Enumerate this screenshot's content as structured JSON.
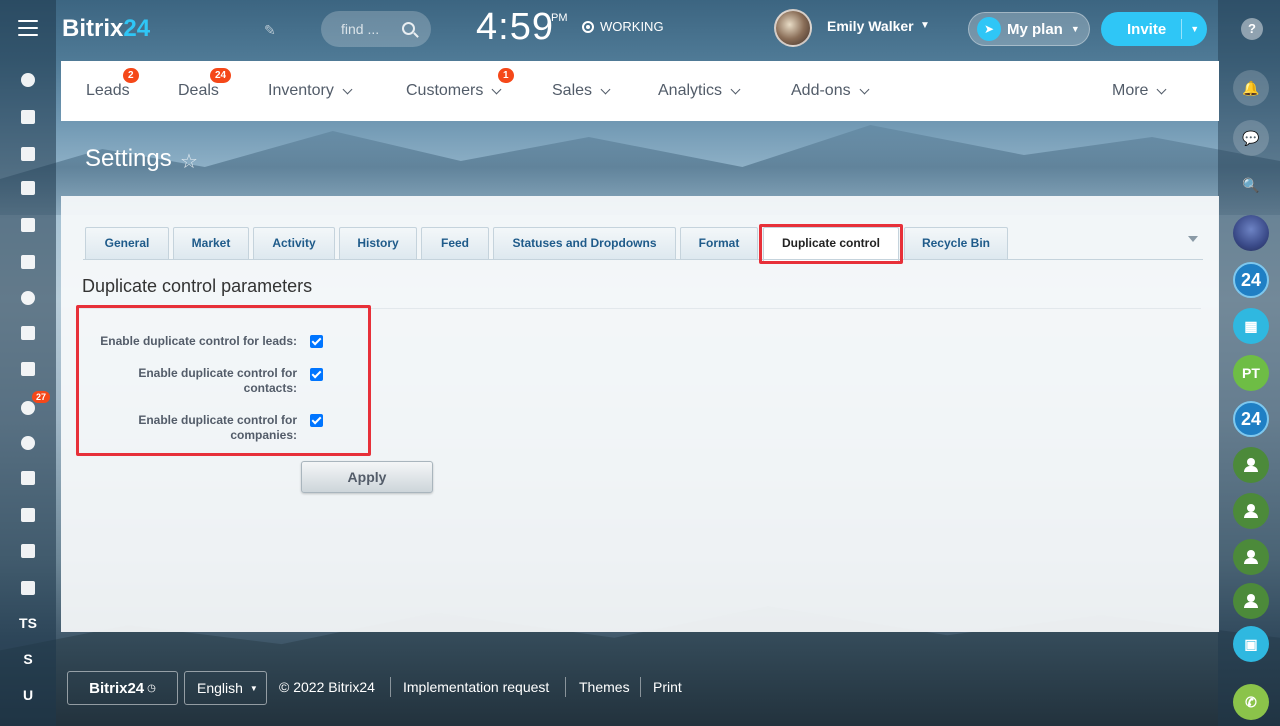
{
  "header": {
    "logo_main": "Bitrix",
    "logo_accent": "24",
    "search_placeholder": "find ...",
    "time": "4:59",
    "time_suffix": "PM",
    "work_status": "WORKING",
    "user_name": "Emily Walker",
    "plan_label": "My plan",
    "invite_label": "Invite"
  },
  "left_sidebar": {
    "counter_badge": "27",
    "text_items": [
      "TS",
      "S",
      "U"
    ]
  },
  "right_sidebar": {
    "help": "?",
    "items": [
      "24",
      "PT",
      "24"
    ]
  },
  "nav": {
    "items": [
      {
        "label": "Leads",
        "badge": "2"
      },
      {
        "label": "Deals",
        "badge": "24"
      },
      {
        "label": "Inventory"
      },
      {
        "label": "Customers",
        "badge": "1"
      },
      {
        "label": "Sales"
      },
      {
        "label": "Analytics"
      },
      {
        "label": "Add-ons"
      },
      {
        "label": "More"
      }
    ]
  },
  "page": {
    "title": "Settings"
  },
  "tabs": [
    {
      "label": "General"
    },
    {
      "label": "Market"
    },
    {
      "label": "Activity"
    },
    {
      "label": "History"
    },
    {
      "label": "Feed"
    },
    {
      "label": "Statuses and Dropdowns"
    },
    {
      "label": "Format"
    },
    {
      "label": "Duplicate control",
      "active": true
    },
    {
      "label": "Recycle Bin"
    }
  ],
  "section": {
    "title": "Duplicate control parameters",
    "options": [
      {
        "label_line1": "Enable duplicate control for leads:",
        "label_line2": "",
        "checked": true
      },
      {
        "label_line1": "Enable duplicate control for",
        "label_line2": "contacts:",
        "checked": true
      },
      {
        "label_line1": "Enable duplicate control for",
        "label_line2": "companies:",
        "checked": true
      }
    ],
    "apply_label": "Apply"
  },
  "footer": {
    "brand": "Bitrix24",
    "language": "English",
    "copyright": "© 2022 Bitrix24",
    "links": [
      "Implementation request",
      "Themes",
      "Print"
    ]
  },
  "colors": {
    "accent": "#2fc6f6",
    "badge": "#f54819",
    "highlight": "#e73039",
    "checkbox": "#0075ff"
  }
}
